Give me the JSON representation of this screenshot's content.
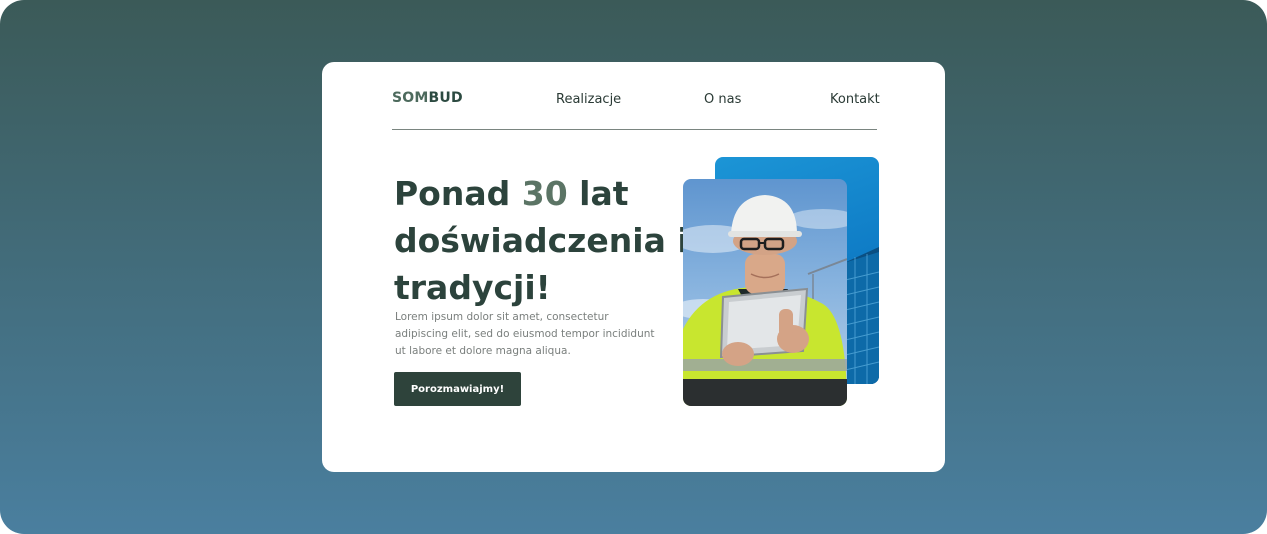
{
  "brand": {
    "logo_part1": "SOM",
    "logo_part2": "BUD"
  },
  "nav": {
    "items": [
      {
        "label": "Realizacje"
      },
      {
        "label": "O nas"
      },
      {
        "label": "Kontakt"
      }
    ]
  },
  "hero": {
    "headline_before": "Ponad ",
    "headline_accent": "30",
    "headline_after": " lat doświadczenia i tradycji!",
    "description": "Lorem ipsum dolor sit amet, consectetur adipiscing elit, sed do eiusmod tempor incididunt ut labore et dolore magna aliqua.",
    "cta_label": "Porozmawiajmy!"
  },
  "colors": {
    "background_top": "#3b5a58",
    "background_bottom": "#4a7f9f",
    "brand_dark": "#2e433b",
    "accent_blue": "#1c95d6"
  }
}
